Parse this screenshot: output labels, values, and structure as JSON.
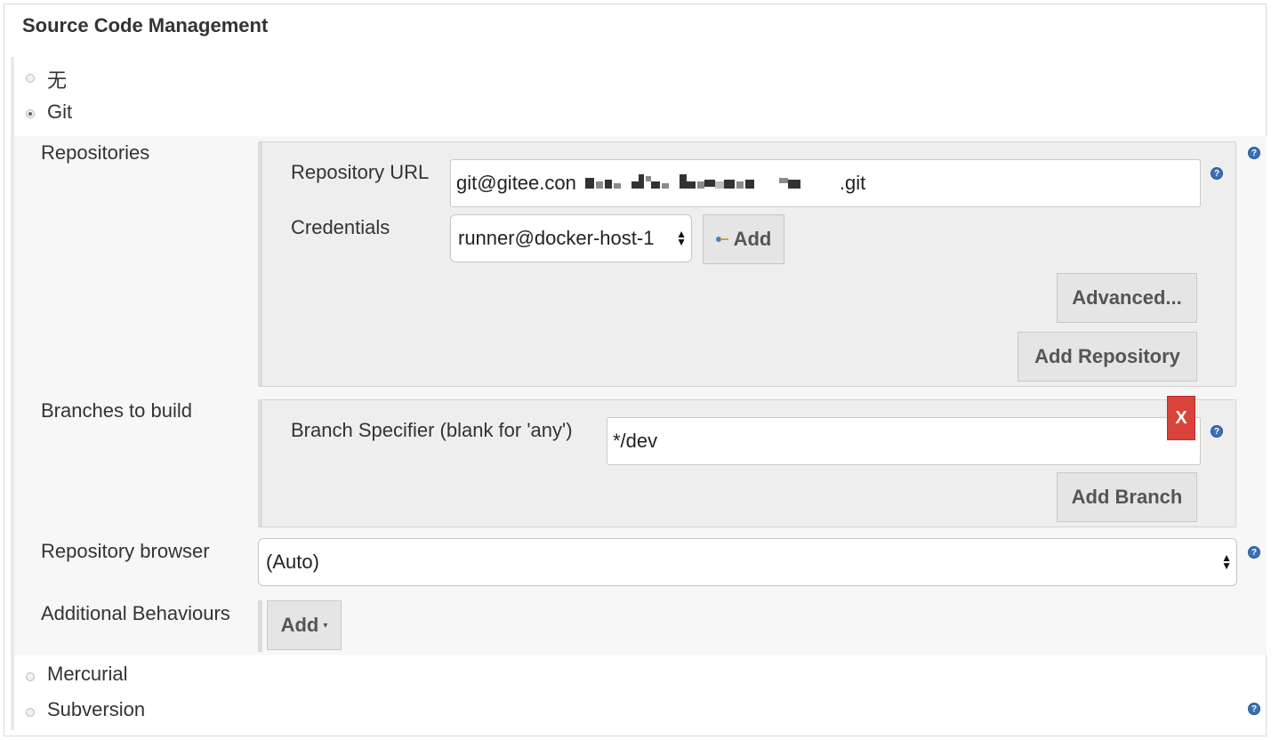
{
  "section": {
    "title": "Source Code Management"
  },
  "scm_options": {
    "none": "无",
    "git": "Git",
    "mercurial": "Mercurial",
    "subversion": "Subversion"
  },
  "git": {
    "repositories": {
      "label": "Repositories",
      "url_label": "Repository URL",
      "url_prefix": "git@gitee.con",
      "url_suffix": ".git",
      "credentials_label": "Credentials",
      "credentials_value": "runner@docker-host-1",
      "add_credentials_label": "Add",
      "advanced_label": "Advanced...",
      "add_repository_label": "Add Repository"
    },
    "branches": {
      "label": "Branches to build",
      "specifier_label": "Branch Specifier (blank for 'any')",
      "specifier_value": "*/dev",
      "delete_label": "X",
      "add_branch_label": "Add Branch"
    },
    "repository_browser": {
      "label": "Repository browser",
      "value": "(Auto)"
    },
    "additional_behaviours": {
      "label": "Additional Behaviours",
      "add_label": "Add"
    }
  },
  "icons": {
    "help": "help-icon",
    "key": "key-icon",
    "dropdown": "caret-down-icon",
    "updown": "select-arrows-icon"
  },
  "colors": {
    "help": "#3b6fb6",
    "delete": "#d9433b",
    "panel": "#eeeeee",
    "button": "#e5e5e5"
  }
}
